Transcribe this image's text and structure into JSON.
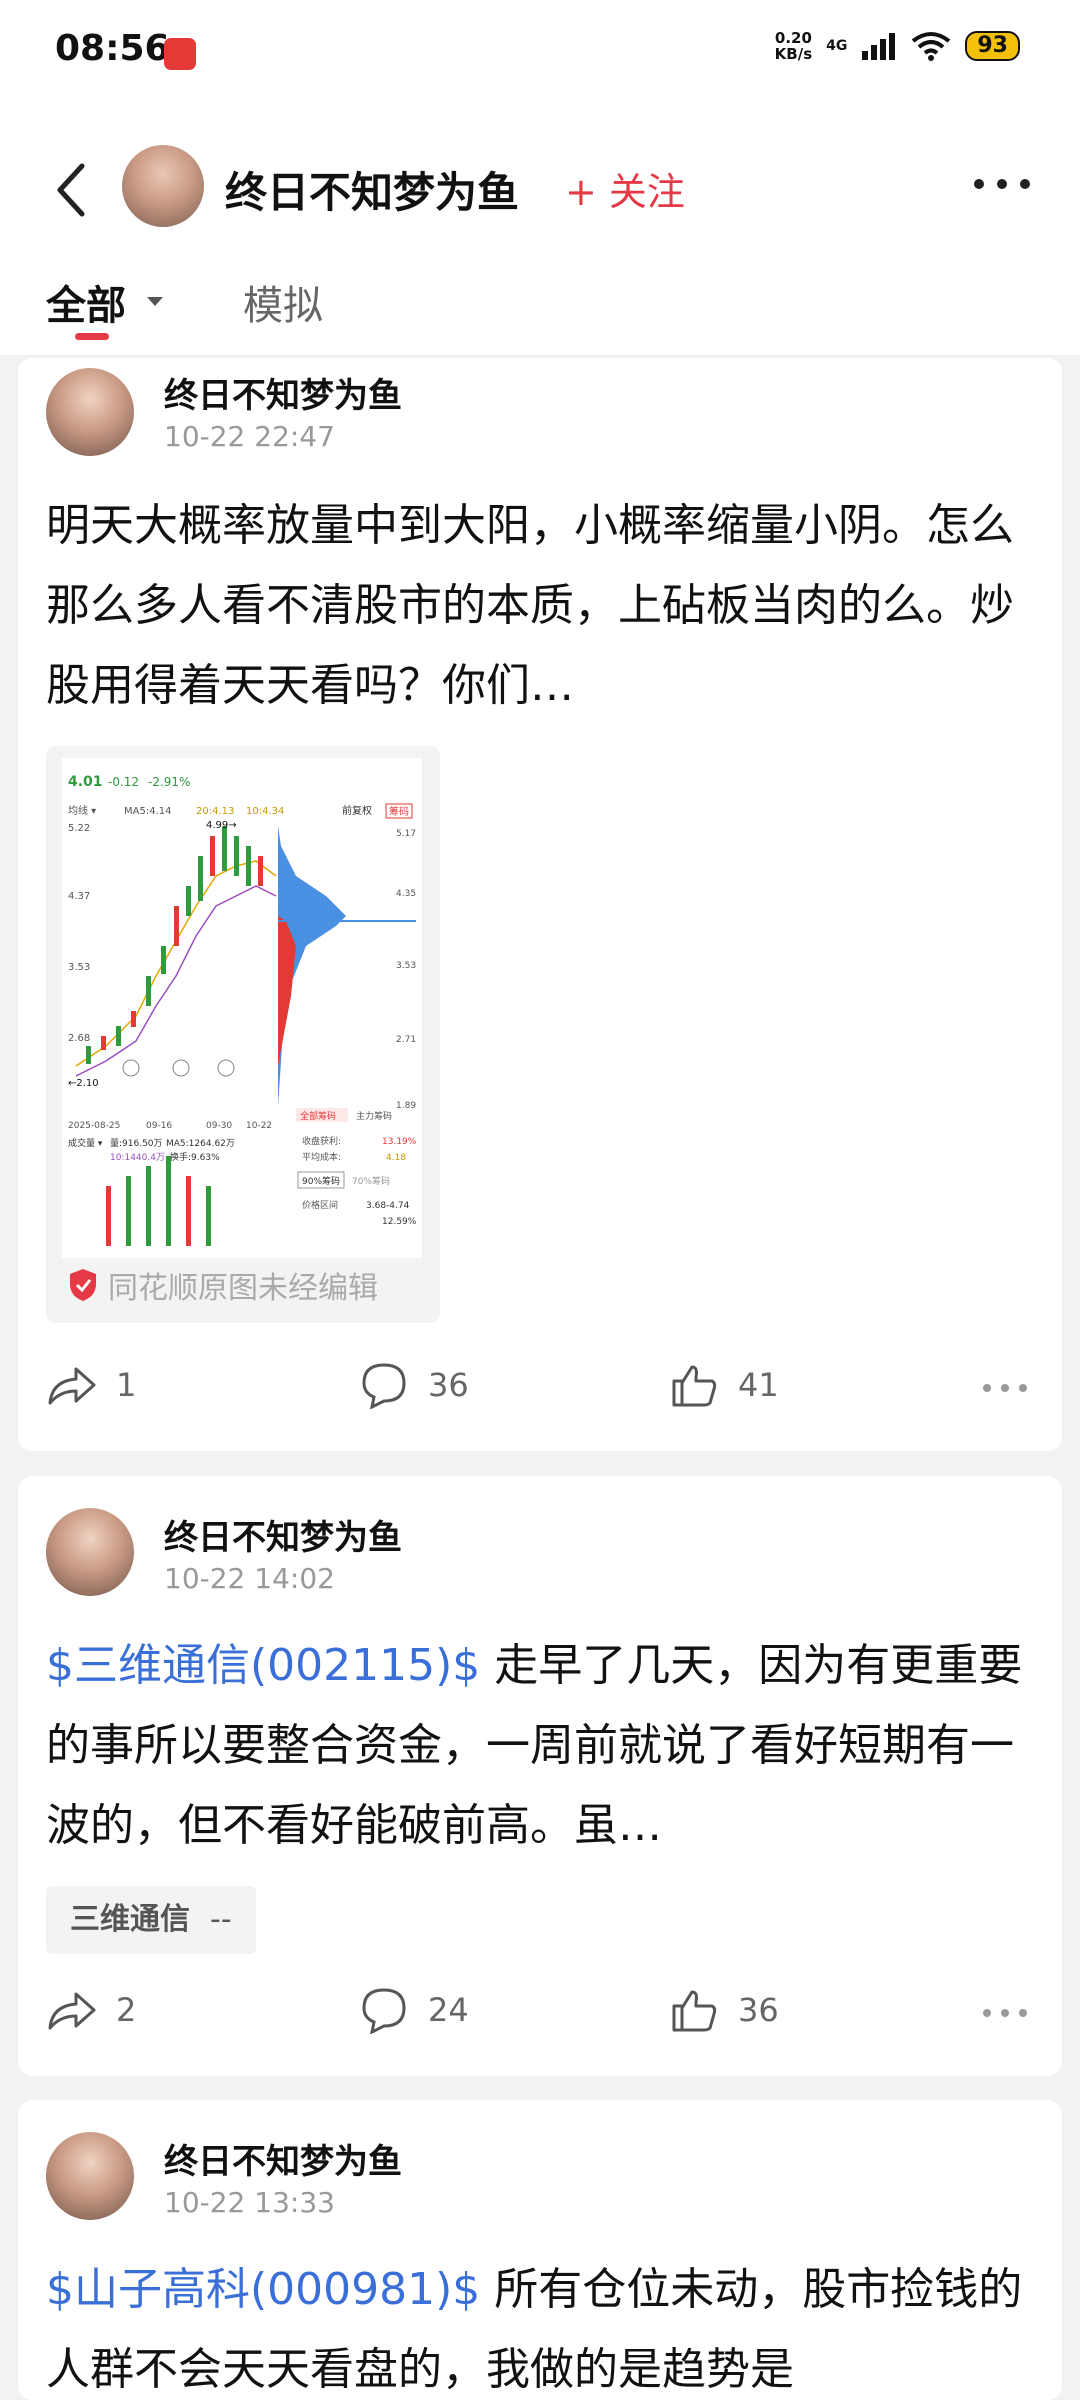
{
  "status": {
    "time": "08:56",
    "net_speed_value": "0.20",
    "net_speed_unit": "KB/s",
    "network": "4G",
    "battery": "93"
  },
  "header": {
    "author": "终日不知梦为鱼",
    "follow_label": "+ 关注"
  },
  "tabs": [
    {
      "label": "全部",
      "active": true
    },
    {
      "label": "模拟",
      "active": false
    }
  ],
  "posts": [
    {
      "author": "终日不知梦为鱼",
      "time": "10-22 22:47",
      "text": "明天大概率放量中到大阳，小概率缩量小阴。怎么那么多人看不清股市的本质，上砧板当肉的么。炒股用得着天天看吗？你们…",
      "image_note": "同花顺原图未经编辑",
      "chart": {
        "price": "4.01",
        "change": "-0.12",
        "change_pct": "-2.91%",
        "ma5": "MA5:4.14",
        "ma20": "20:4.13",
        "ma_last": "10:4.34",
        "high_label": "4.99",
        "low_label": "2.10",
        "y_left": [
          "5.22",
          "4.37",
          "3.53",
          "2.68"
        ],
        "y_right": [
          "5.17",
          "4.35",
          "3.53",
          "2.71",
          "1.89"
        ],
        "dates": [
          "2025-08-25",
          "09-16",
          "09-30",
          "10-22"
        ],
        "tab_a": "全部筹码",
        "tab_b": "主力筹码",
        "profit_label": "收盘获利:",
        "profit_value": "13.19%",
        "avg_cost_label": "平均成本:",
        "avg_cost_value": "4.18",
        "pct90": "90%筹码",
        "pct70": "70%筹码",
        "range_label": "价格区间",
        "range_value": "3.68-4.74",
        "conc_value": "12.59%",
        "volume_label": "成交量",
        "volume_value": "量:916.50万",
        "volume_ma5": "MA5:1264.62万",
        "turnover": "换手:9.63%",
        "vol_extra": "10:1440.4万",
        "before_label": "前复权",
        "chips_label": "筹码"
      },
      "shares": "1",
      "comments": "36",
      "likes": "41"
    },
    {
      "author": "终日不知梦为鱼",
      "time": "10-22 14:02",
      "stock": "$三维通信(002115)$",
      "text": " 走早了几天，因为有更重要的事所以要整合资金，一周前就说了看好短期有一波的，但不看好能破前高。虽…",
      "tag_name": "三维通信",
      "tag_value": "--",
      "shares": "2",
      "comments": "24",
      "likes": "36"
    },
    {
      "author": "终日不知梦为鱼",
      "time": "10-22 13:33",
      "stock": "$山子高科(000981)$",
      "text": " 所有仓位未动，股市捡钱的人群不会天天看盘的，我做的是趋势是"
    }
  ]
}
